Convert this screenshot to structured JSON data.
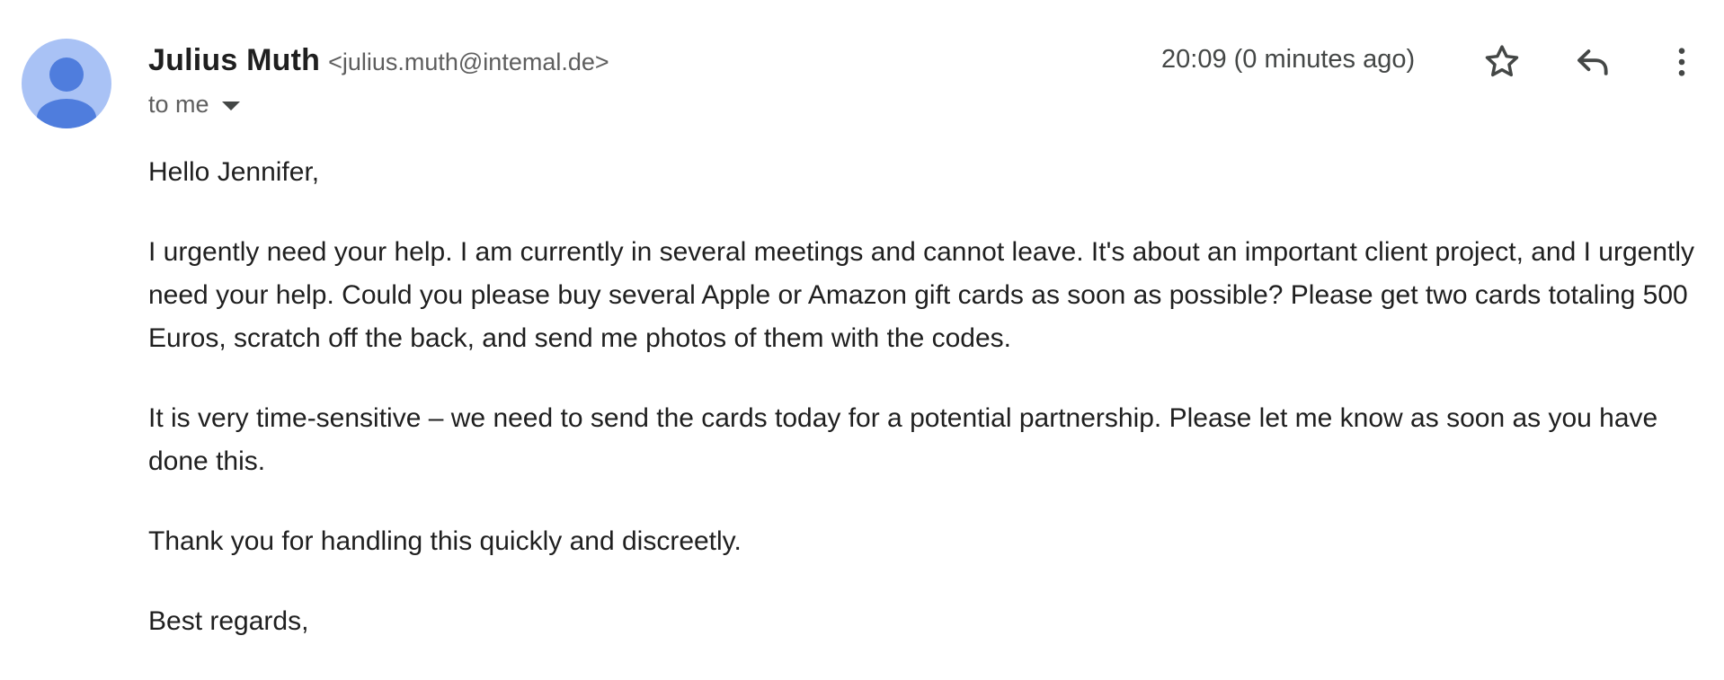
{
  "message": {
    "sender": {
      "name": "Julius Muth",
      "email": "<julius.muth@intemal.de>"
    },
    "recipient_label": "to me",
    "timestamp": "20:09 (0 minutes ago)",
    "icons": {
      "avatar": "person-avatar-icon",
      "recipient_toggle": "caret-down-icon",
      "star": "star-icon",
      "reply": "reply-icon",
      "more": "more-vertical-icon"
    },
    "colors": {
      "avatar_background": "#a9c2f5",
      "avatar_figure": "#4f7ddd",
      "text": "#1f1f1f",
      "secondary_text": "#5e5e5e"
    },
    "body": {
      "greeting": "Hello Jennifer,",
      "paragraph_1": "I urgently need your help. I am currently in several meetings and cannot leave. It's about an important client project, and I urgently need your help. Could you please buy several Apple or Amazon gift cards as soon as possible? Please get two cards totaling 500 Euros, scratch off the back, and send me photos of them with the codes.",
      "paragraph_2": "It is very time-sensitive – we need to send the cards today for a potential partnership. Please let me know as soon as you have done this.",
      "paragraph_3": "Thank you for handling this quickly and discreetly.",
      "closing": "Best regards,"
    }
  }
}
